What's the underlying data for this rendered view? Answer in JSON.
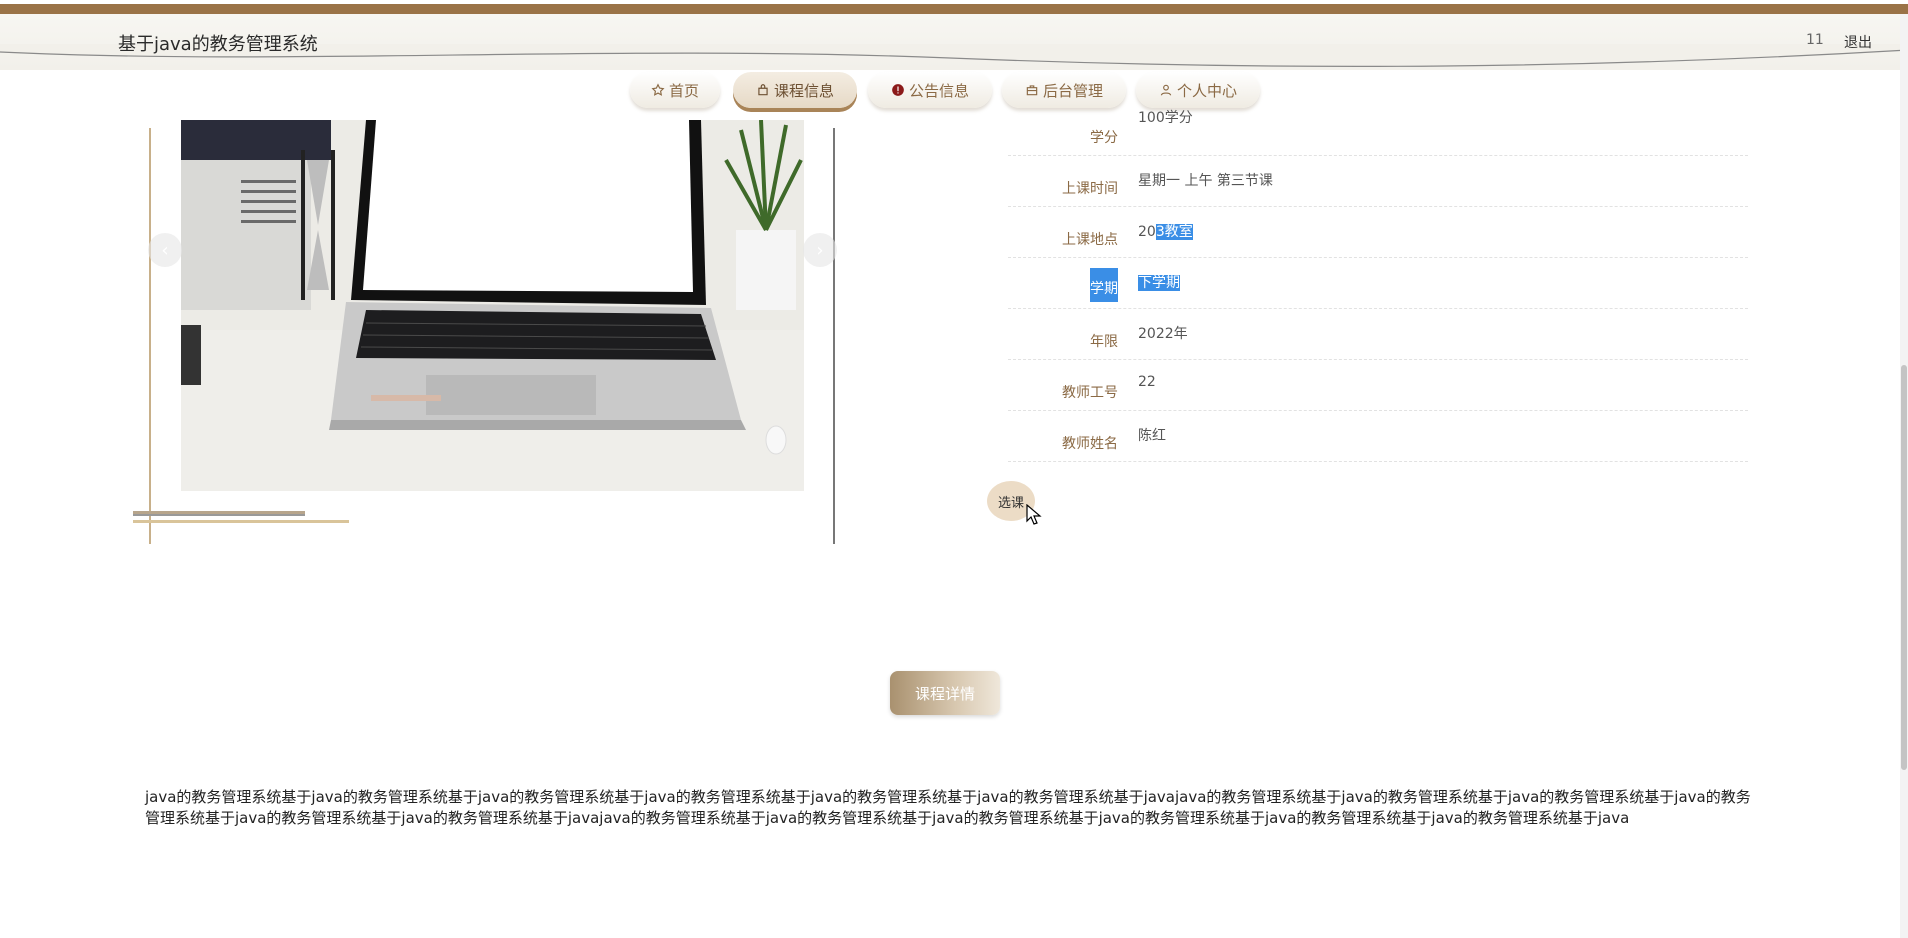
{
  "header": {
    "site_title": "基于java的教务管理系统",
    "user_name": "11",
    "logout_label": "退出"
  },
  "nav": {
    "items": [
      {
        "label": "首页",
        "icon": "star-icon"
      },
      {
        "label": "课程信息",
        "icon": "bag-icon"
      },
      {
        "label": "公告信息",
        "icon": "alert-circle-icon"
      },
      {
        "label": "后台管理",
        "icon": "briefcase-icon"
      },
      {
        "label": "个人中心",
        "icon": "user-icon"
      }
    ],
    "active_index": 1
  },
  "carousel": {
    "prev_label": "‹",
    "next_label": "›"
  },
  "course_info": {
    "rows": [
      {
        "label": "学分",
        "value": "100学分"
      },
      {
        "label": "上课时间",
        "value": "星期一 上午 第三节课"
      },
      {
        "label": "上课地点",
        "value_prefix": "20",
        "value_selected": "3教室"
      },
      {
        "label": "学期",
        "value_selected": "下学期"
      },
      {
        "label": "年限",
        "value": "2022年"
      },
      {
        "label": "教师工号",
        "value": "22"
      },
      {
        "label": "教师姓名",
        "value": "陈红"
      }
    ]
  },
  "actions": {
    "select_course_label": "选课",
    "course_detail_label": "课程详情"
  },
  "description": {
    "text": "java的教务管理系统基于java的教务管理系统基于java的教务管理系统基于java的教务管理系统基于java的教务管理系统基于java的教务管理系统基于javajava的教务管理系统基于java的教务管理系统基于java的教务管理系统基于java的教务管理系统基于java的教务管理系统基于java的教务管理系统基于javajava的教务管理系统基于java的教务管理系统基于java的教务管理系统基于java的教务管理系统基于java的教务管理系统基于java的教务管理系统基于java"
  },
  "colors": {
    "brand_brown": "#9a7347",
    "label_brown": "#8b6a45",
    "selection_blue": "#3a8ee6"
  }
}
